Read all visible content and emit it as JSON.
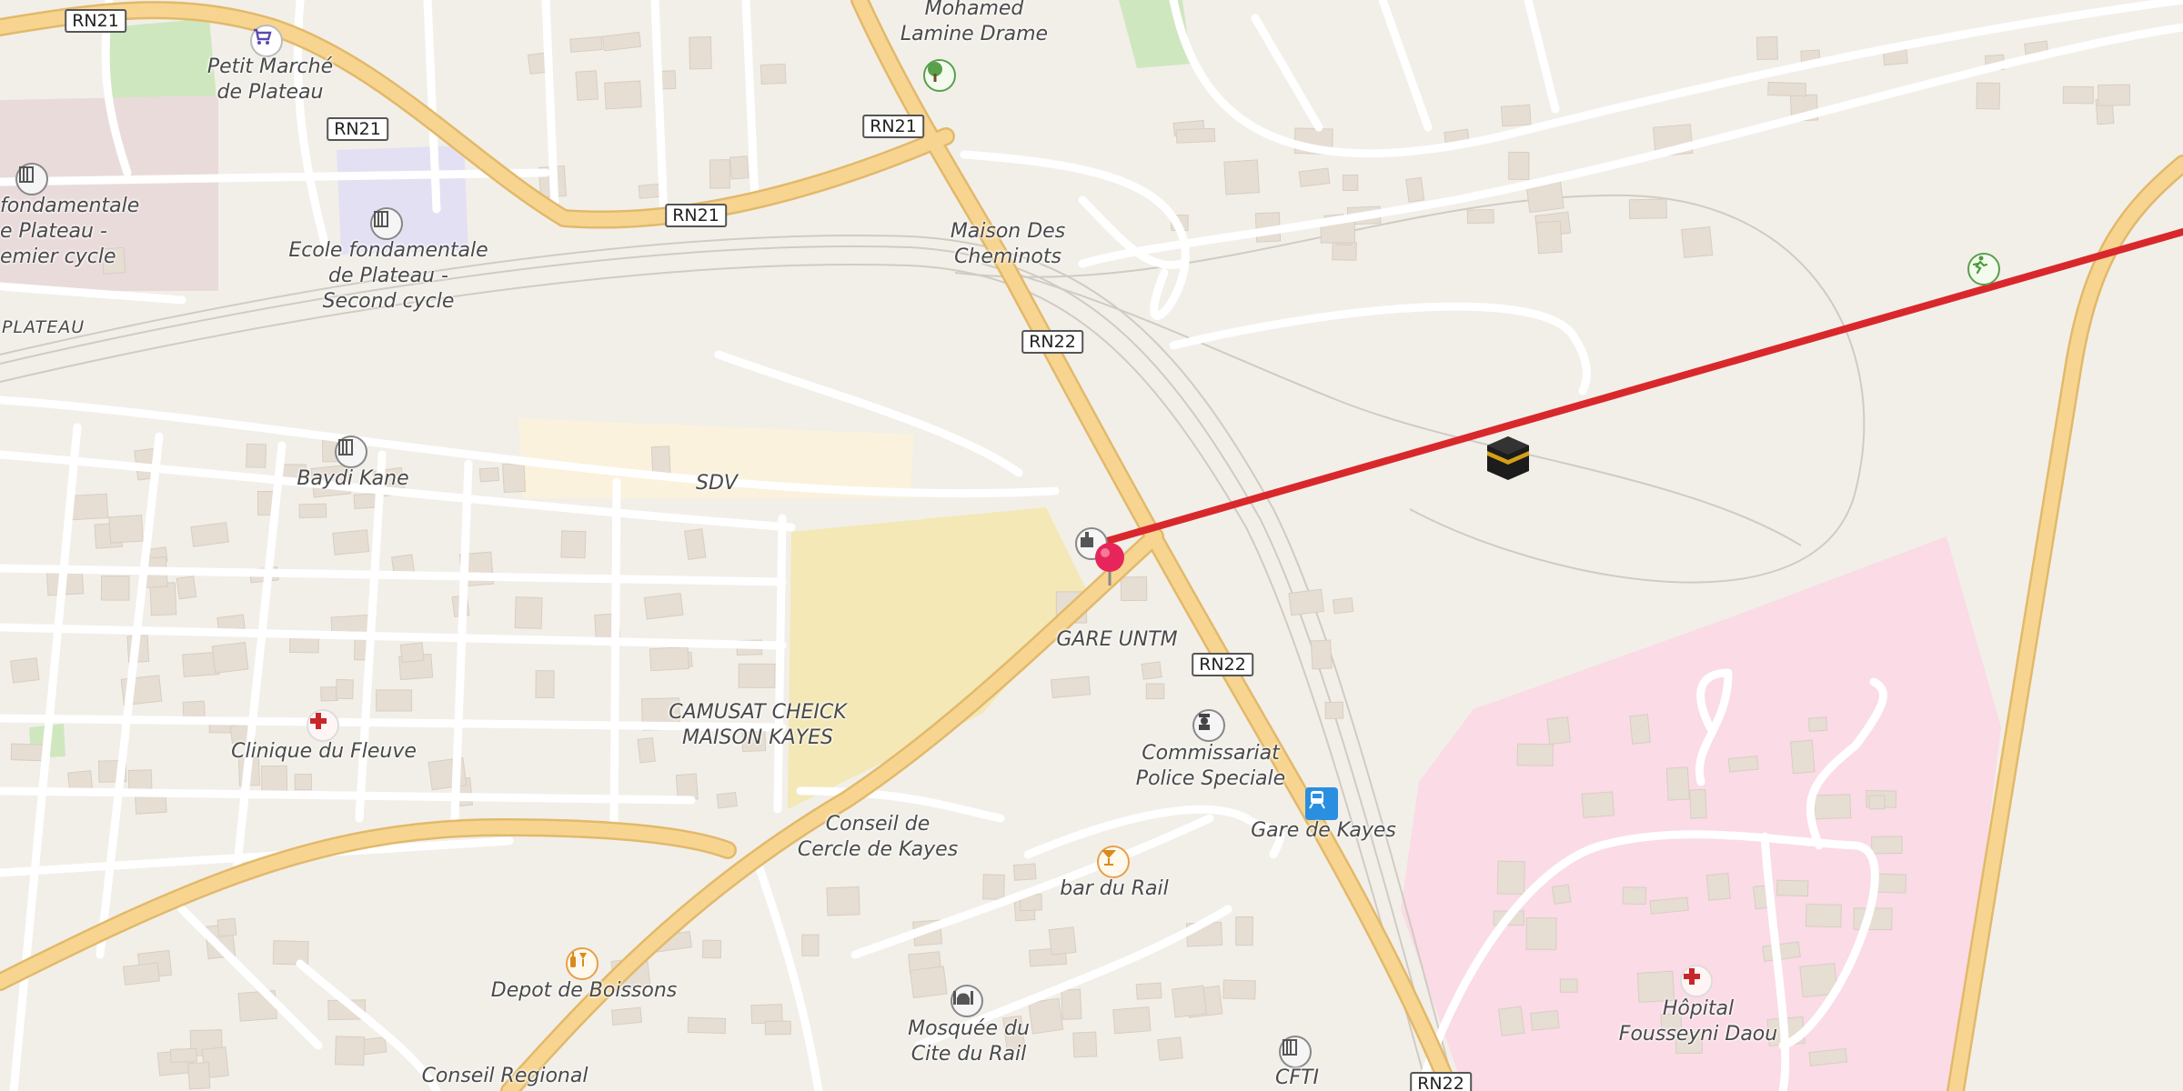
{
  "map": {
    "roads": {
      "shields": [
        "RN21",
        "RN21",
        "RN21",
        "RN21",
        "RN22",
        "RN22",
        "RN22"
      ]
    },
    "labels": {
      "mohamed": "Mohamed\nLamine Drame",
      "petit_marche": "Petit Marché\nde Plateau",
      "ecole_premier": "fondamentale\ne Plateau -\nemier cycle",
      "ecole_second": "Ecole fondamentale\nde Plateau -\nSecond cycle",
      "plateau": "PLATEAU",
      "maison_cheminots": "Maison Des\nCheminots",
      "baydi": "Baydi Kane",
      "sdv": "SDV",
      "gare_untm": "GARE UNTM",
      "camusat": "CAMUSAT CHEICK\nMAISON KAYES",
      "clinique": "Clinique du Fleuve",
      "commissariat": "Commissariat\nPolice Speciale",
      "gare_kayes": "Gare de Kayes",
      "conseil_cercle": "Conseil de\nCercle de Kayes",
      "bar_rail": "bar du Rail",
      "depot": "Depot de Boissons",
      "mosquee": "Mosquée du\nCite du Rail",
      "conseil_regional": "Conseil Regional",
      "cfti": "CFTI",
      "hopital": "Hôpital\nFousseyni Daou"
    },
    "icons": {
      "shop": "shopping-cart-icon",
      "tree": "tree-icon",
      "school": "school-icon",
      "hospital": "red-cross-icon",
      "police": "police-icon",
      "train": "train-station-icon",
      "bar": "cocktail-icon",
      "liquor": "bottle-glass-icon",
      "mosque": "mosque-icon",
      "sport": "running-person-icon",
      "pin": "location-pin-icon",
      "kaaba": "kaaba-icon"
    },
    "colors": {
      "background": "#f2efe9",
      "primary_road": "#f7d591",
      "primary_road_casing": "#e2b96a",
      "minor_road": "#ffffff",
      "building": "#e6ddd3",
      "hospital_area": "#fadbe6",
      "sand_area": "#f3e8b6",
      "park": "#cfe7bf",
      "route_line": "#d9282b",
      "pin": "#e8255a"
    }
  }
}
